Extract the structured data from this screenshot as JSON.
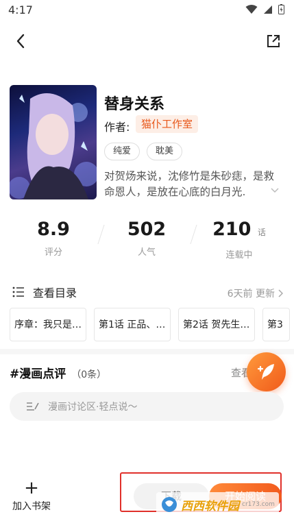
{
  "status_bar": {
    "time": "4:17"
  },
  "comic": {
    "title": "替身关系",
    "author_label": "作者:",
    "author": "猫仆工作室",
    "tags": [
      "纯爱",
      "耽美"
    ],
    "description": "对贺炀来说，沈修竹是朱砂痣，是救命恩人，是放在心底的白月光."
  },
  "stats": [
    {
      "value": "8.9",
      "unit": "",
      "label": "评分"
    },
    {
      "value": "502",
      "unit": "",
      "label": "人气"
    },
    {
      "value": "210",
      "unit": "话",
      "label": "连载中"
    }
  ],
  "catalog": {
    "title": "查看目录",
    "update": "6天前 更新",
    "chapters": [
      "序章：我只是…",
      "第1话 正品、…",
      "第2话 贺先生…",
      "第3"
    ]
  },
  "comments": {
    "title": "#漫画点评",
    "count": "（0条）",
    "more": "查看",
    "placeholder": "漫画讨论区·轻点说～"
  },
  "bottom_bar": {
    "add_shelf": "加入书架",
    "download": "下载",
    "read": "开始阅读"
  },
  "watermark": {
    "text": "西西软件园",
    "url": "cr173.com"
  },
  "colors": {
    "accent": "#f25b1e",
    "frame": "#e0302a"
  }
}
